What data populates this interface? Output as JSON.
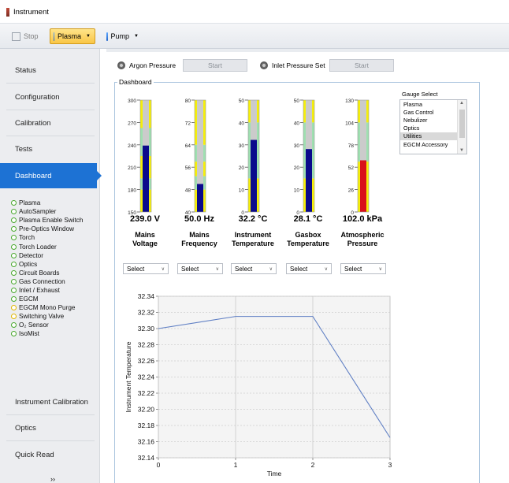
{
  "window": {
    "title": "Instrument"
  },
  "toolbar": {
    "stop_label": "Stop",
    "plasma_label": "Plasma",
    "pump_label": "Pump"
  },
  "sidebar": {
    "items": [
      "Status",
      "Configuration",
      "Calibration",
      "Tests",
      "Dashboard"
    ],
    "active": "Dashboard",
    "subitems": [
      {
        "label": "Plasma",
        "status": "green"
      },
      {
        "label": "AutoSampler",
        "status": "green"
      },
      {
        "label": "Plasma Enable Switch",
        "status": "green"
      },
      {
        "label": "Pre-Optics Window",
        "status": "green"
      },
      {
        "label": "Torch",
        "status": "green"
      },
      {
        "label": "Torch Loader",
        "status": "green"
      },
      {
        "label": "Detector",
        "status": "green"
      },
      {
        "label": "Optics",
        "status": "green"
      },
      {
        "label": "Circuit Boards",
        "status": "green"
      },
      {
        "label": "Gas Connection",
        "status": "green"
      },
      {
        "label": "Inlet / Exhaust",
        "status": "green"
      },
      {
        "label": "EGCM",
        "status": "green"
      },
      {
        "label": "EGCM Mono Purge",
        "status": "yellow"
      },
      {
        "label": "Switching Valve",
        "status": "yellow"
      },
      {
        "label": "O₂ Sensor",
        "status": "green"
      },
      {
        "label": "IsoMist",
        "status": "green"
      }
    ],
    "bottom_items": [
      "Instrument Calibration",
      "Optics",
      "Quick Read"
    ],
    "more_label": "››"
  },
  "controls": {
    "argon_label": "Argon Pressure",
    "argon_start": "Start",
    "inlet_label": "Inlet Pressure Set",
    "inlet_start": "Start"
  },
  "dashboard": {
    "title": "Dashboard",
    "select_label": "Select",
    "gauges": [
      {
        "name": "Mains Voltage",
        "line1": "Mains",
        "line2": "Voltage",
        "value_text": "239.0 V",
        "min": 150,
        "max": 300,
        "value": 239.0,
        "ticks": [
          150,
          180,
          210,
          240,
          270,
          300
        ],
        "bar_color": "#0a0a8c",
        "zones": [
          [
            0,
            0.2,
            "#f5ef0a"
          ],
          [
            0.2,
            0.3,
            "#9ee0b0"
          ],
          [
            0.3,
            0.5,
            "#f5ef0a"
          ],
          [
            0.5,
            0.75,
            "#9ee0b0"
          ],
          [
            0.75,
            1,
            "#f5ef0a"
          ]
        ]
      },
      {
        "name": "Mains Frequency",
        "line1": "Mains",
        "line2": "Frequency",
        "value_text": "50.0 Hz",
        "min": 40,
        "max": 80,
        "value": 50.0,
        "ticks": [
          40,
          48,
          56,
          64,
          72,
          80
        ],
        "bar_color": "#0a0a8c",
        "zones": [
          [
            0,
            0.2,
            "#f5ef0a"
          ],
          [
            0.2,
            0.32,
            "#9ee0b0"
          ],
          [
            0.32,
            0.45,
            "#f5ef0a"
          ],
          [
            0.45,
            0.6,
            "#9ee0b0"
          ],
          [
            0.6,
            1,
            "#f5ef0a"
          ]
        ]
      },
      {
        "name": "Instrument Temperature",
        "line1": "Instrument",
        "line2": "Temperature",
        "value_text": "32.2 °C",
        "min": 0,
        "max": 50,
        "value": 32.2,
        "ticks": [
          0,
          10,
          20,
          30,
          40,
          50
        ],
        "bar_color": "#0a0a8c",
        "zones": [
          [
            0,
            0.3,
            "#f5ef0a"
          ],
          [
            0.3,
            0.8,
            "#9ee0b0"
          ],
          [
            0.8,
            1,
            "#f5ef0a"
          ]
        ]
      },
      {
        "name": "Gasbox Temperature",
        "line1": "Gasbox",
        "line2": "Temperature",
        "value_text": "28.1 °C",
        "min": 0,
        "max": 50,
        "value": 28.1,
        "ticks": [
          0,
          10,
          20,
          30,
          40,
          50
        ],
        "bar_color": "#0a0a8c",
        "zones": [
          [
            0,
            0.3,
            "#f5ef0a"
          ],
          [
            0.3,
            0.8,
            "#9ee0b0"
          ],
          [
            0.8,
            1,
            "#f5ef0a"
          ]
        ]
      },
      {
        "name": "Atmospheric Pressure",
        "line1": "Atmospheric",
        "line2": "Pressure",
        "value_text": "102.0 kPa",
        "min": 0,
        "max": 130,
        "value": 60,
        "ticks": [
          0,
          26,
          52,
          78,
          104,
          130
        ],
        "bar_color": "#d9101a",
        "zones": [
          [
            0,
            0.45,
            "#f5ef0a"
          ],
          [
            0.45,
            0.8,
            "#9ee0b0"
          ],
          [
            0.8,
            1,
            "#f5ef0a"
          ]
        ]
      }
    ],
    "gauge_select": {
      "title": "Gauge Select",
      "options": [
        "Plasma",
        "Gas Control",
        "Nebulizer",
        "Optics",
        "Utilities",
        "EGCM Accessory"
      ],
      "selected": "Utilities"
    }
  },
  "chart_data": {
    "type": "line",
    "x": [
      0,
      1,
      2,
      3
    ],
    "series": [
      {
        "values": [
          32.3,
          32.315,
          32.315,
          32.165
        ]
      }
    ],
    "xlabel": "Time",
    "ylabel": "Instrument Temperature",
    "xlim": [
      0,
      3
    ],
    "ylim": [
      32.14,
      32.34
    ],
    "xticks": [
      0,
      1,
      2,
      3
    ],
    "yticks": [
      32.14,
      32.16,
      32.18,
      32.2,
      32.22,
      32.24,
      32.26,
      32.28,
      32.3,
      32.32,
      32.34
    ],
    "grid": true,
    "line_color": "#5f7fc4"
  }
}
